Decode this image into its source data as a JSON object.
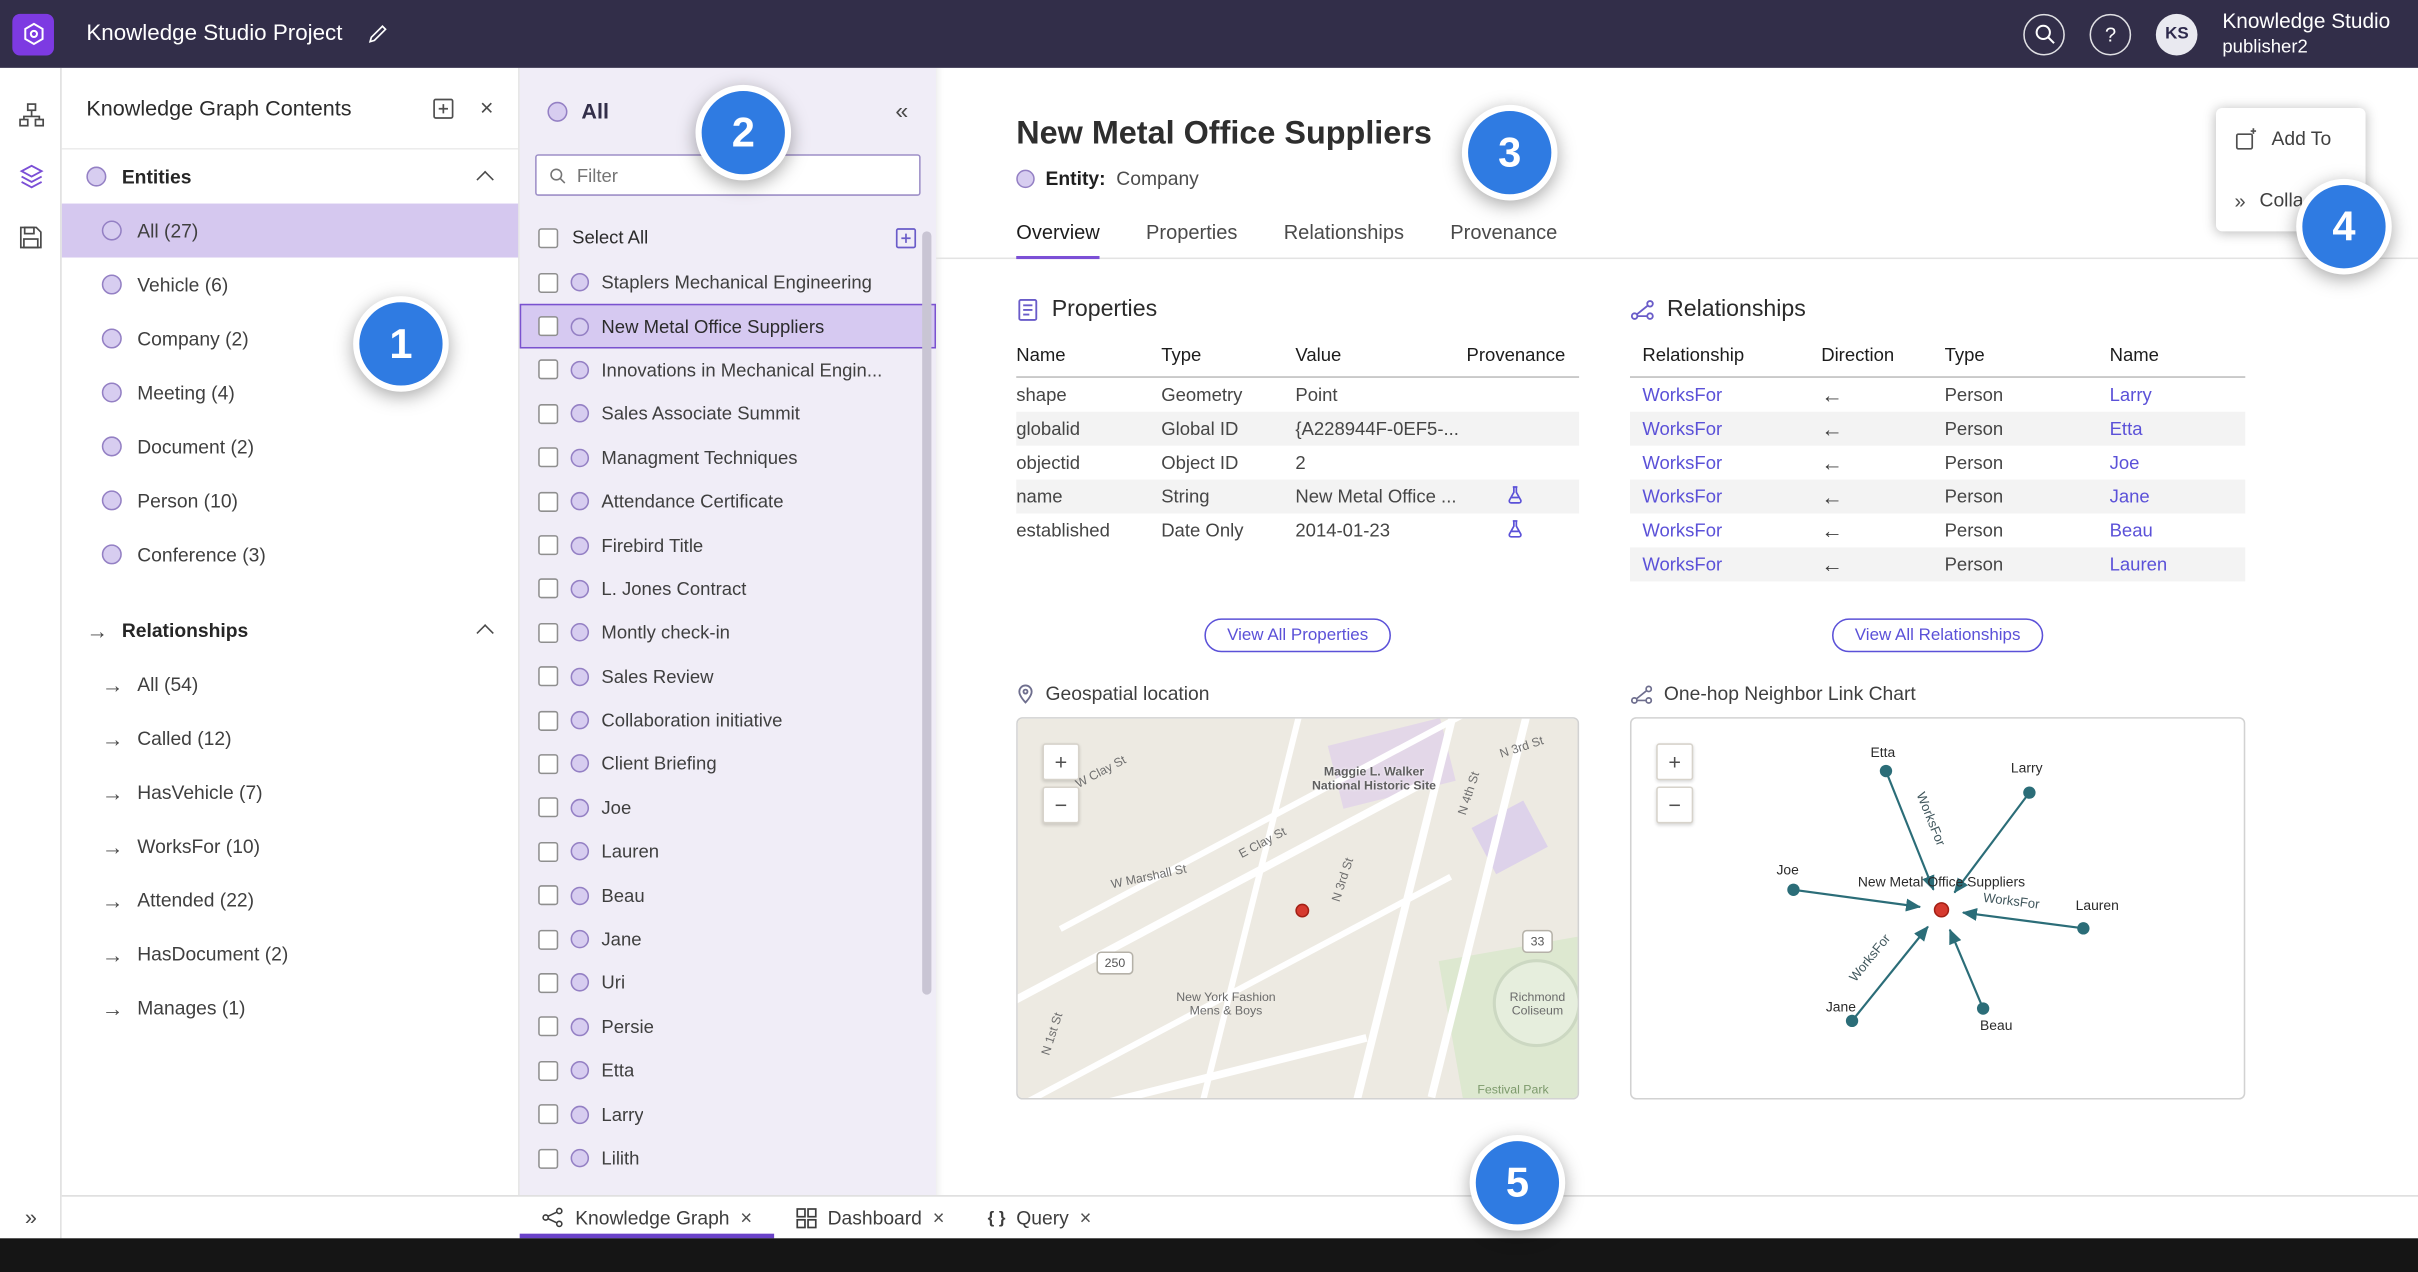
{
  "icons": {
    "close": "×",
    "collapse": "«",
    "expand": "»",
    "arrow_right": "→",
    "help": "?",
    "plus": "+",
    "minus": "−",
    "braces": "{ }"
  },
  "colors": {
    "accent_purple": "#7b4fd6",
    "link": "#5b51d8",
    "callout_blue": "#2f7be2",
    "graph_teal": "#2b6d78",
    "marker_red": "#d63a2f",
    "topbar": "#322e49"
  },
  "topbar": {
    "project_title": "Knowledge Studio Project",
    "app_name": "Knowledge Studio",
    "username": "publisher2",
    "avatar_initials": "KS"
  },
  "contents_panel": {
    "title": "Knowledge Graph Contents",
    "entities_header": "Entities",
    "relationships_header": "Relationships",
    "entities": [
      {
        "label": "All (27)",
        "selected": true
      },
      {
        "label": "Vehicle (6)"
      },
      {
        "label": "Company (2)"
      },
      {
        "label": "Meeting (4)"
      },
      {
        "label": "Document (2)"
      },
      {
        "label": "Person (10)"
      },
      {
        "label": "Conference (3)"
      }
    ],
    "relationships": [
      {
        "label": "All (54)"
      },
      {
        "label": "Called (12)"
      },
      {
        "label": "HasVehicle (7)"
      },
      {
        "label": "WorksFor (10)"
      },
      {
        "label": "Attended (22)"
      },
      {
        "label": "HasDocument (2)"
      },
      {
        "label": "Manages (1)"
      }
    ]
  },
  "list_panel": {
    "title": "All",
    "filter_placeholder": "Filter",
    "select_all_label": "Select All",
    "items": [
      {
        "label": "Staplers Mechanical Engineering"
      },
      {
        "label": "New Metal Office Suppliers",
        "selected": true
      },
      {
        "label": "Innovations in Mechanical Engin..."
      },
      {
        "label": "Sales Associate Summit"
      },
      {
        "label": "Managment Techniques"
      },
      {
        "label": "Attendance Certificate"
      },
      {
        "label": "Firebird Title"
      },
      {
        "label": "L. Jones Contract"
      },
      {
        "label": "Montly check-in"
      },
      {
        "label": "Sales Review"
      },
      {
        "label": "Collaboration initiative"
      },
      {
        "label": "Client Briefing"
      },
      {
        "label": "Joe"
      },
      {
        "label": "Lauren"
      },
      {
        "label": "Beau"
      },
      {
        "label": "Jane"
      },
      {
        "label": "Uri"
      },
      {
        "label": "Persie"
      },
      {
        "label": "Etta"
      },
      {
        "label": "Larry"
      },
      {
        "label": "Lilith"
      }
    ]
  },
  "detail": {
    "title": "New Metal Office Suppliers",
    "entity_label": "Entity:",
    "entity_type": "Company",
    "tabs": [
      {
        "label": "Overview",
        "active": true
      },
      {
        "label": "Properties"
      },
      {
        "label": "Relationships"
      },
      {
        "label": "Provenance"
      }
    ],
    "properties": {
      "heading": "Properties",
      "columns": [
        "Name",
        "Type",
        "Value",
        "Provenance"
      ],
      "rows": [
        {
          "name": "shape",
          "type": "Geometry",
          "value": "Point"
        },
        {
          "name": "globalid",
          "type": "Global ID",
          "value": "{A228944F-0EF5-..."
        },
        {
          "name": "objectid",
          "type": "Object ID",
          "value": "2"
        },
        {
          "name": "name",
          "type": "String",
          "value": "New Metal Office ...",
          "prov": true
        },
        {
          "name": "established",
          "type": "Date Only",
          "value": "2014-01-23",
          "prov": true
        }
      ],
      "view_all_label": "View All Properties"
    },
    "relationships": {
      "heading": "Relationships",
      "columns": [
        "Relationship",
        "Direction",
        "Type",
        "Name"
      ],
      "rows": [
        {
          "relationship": "WorksFor",
          "direction": "←",
          "type": "Person",
          "name": "Larry"
        },
        {
          "relationship": "WorksFor",
          "direction": "←",
          "type": "Person",
          "name": "Etta"
        },
        {
          "relationship": "WorksFor",
          "direction": "←",
          "type": "Person",
          "name": "Joe"
        },
        {
          "relationship": "WorksFor",
          "direction": "←",
          "type": "Person",
          "name": "Jane"
        },
        {
          "relationship": "WorksFor",
          "direction": "←",
          "type": "Person",
          "name": "Beau"
        },
        {
          "relationship": "WorksFor",
          "direction": "←",
          "type": "Person",
          "name": "Lauren"
        }
      ],
      "view_all_label": "View All Relationships"
    },
    "map": {
      "heading": "Geospatial location",
      "labels": {
        "historic_site": "Maggie L. Walker National Historic Site",
        "street_n3rd_top": "N 3rd St",
        "street_n4th": "N 4th St",
        "street_n3rd": "N 3rd St",
        "street_n1st": "N 1st St",
        "street_wclay": "W Clay St",
        "street_eclay": "E Clay St",
        "street_wmarshall": "W Marshall St",
        "store": "New York Fashion Mens & Boys",
        "coliseum": "Richmond Coliseum",
        "park": "Festival Park",
        "route_250": "250",
        "route_33": "33"
      }
    },
    "link_chart": {
      "heading": "One-hop Neighbor Link Chart",
      "center_label": "New Metal Office Suppliers",
      "edge_label": "WorksFor",
      "nodes": [
        "Etta",
        "Larry",
        "Joe",
        "Lauren",
        "Jane",
        "Beau"
      ]
    }
  },
  "context_menu": {
    "items": [
      {
        "label": "Add To"
      },
      {
        "label": "Colla"
      }
    ]
  },
  "bottom_tabs": [
    {
      "label": "Knowledge Graph",
      "active": true
    },
    {
      "label": "Dashboard"
    },
    {
      "label": "Query",
      "active": false
    }
  ],
  "callouts": [
    "1",
    "2",
    "3",
    "4",
    "5"
  ]
}
